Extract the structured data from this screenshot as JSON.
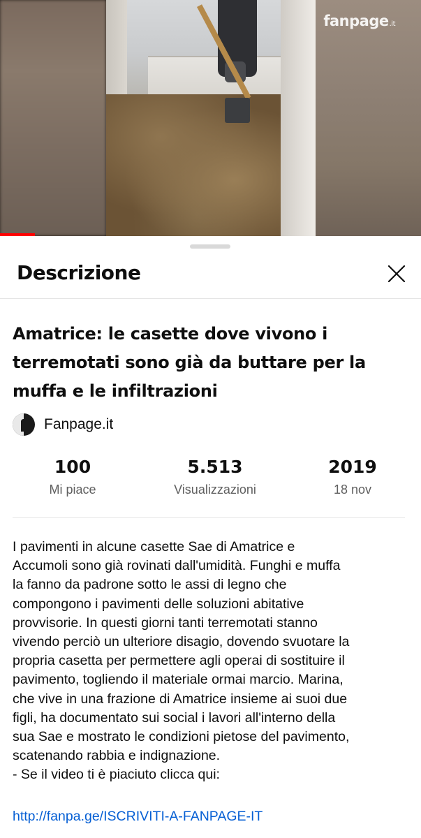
{
  "video": {
    "watermark": "fanpage",
    "watermark_suffix": ".it",
    "progress": 0.083
  },
  "sheet": {
    "title": "Descrizione",
    "close_icon": "close-icon"
  },
  "video_title": "Amatrice: le casette dove vivono i terremotati sono già da buttare per la muffa e le infiltrazioni",
  "channel": {
    "name": "Fanpage.it",
    "avatar_icon": "fanpage-logo-icon"
  },
  "stats": {
    "likes_value": "100",
    "likes_label": "Mi piace",
    "views_value": "5.513",
    "views_label": "Visualizzazioni",
    "year_value": "2019",
    "date_label": "18 nov"
  },
  "description": {
    "text": "I pavimenti in alcune casette Sae di Amatrice e\nAccumoli sono già rovinati dall'umidità. Funghi e muffa\nla fanno da padrone sotto le assi di legno che\ncompongono i pavimenti delle soluzioni abitative\nprovvisorie. In questi giorni tanti terremotati stanno\nvivendo perciò un ulteriore disagio, dovendo svuotare la\npropria casetta per permettere agli operai di sostituire il\npavimento, togliendo il materiale ormai marcio. Marina,\nche vive in una frazione di Amatrice insieme ai suoi due\nfigli, ha documentato sui social i lavori all'interno della\nsua Sae e mostrato le condizioni pietose del pavimento,\nscatenando rabbia e indignazione.\n- Se il video ti è piaciuto clicca qui:",
    "link": "http://fanpa.ge/ISCRIVITI-A-FANPAGE-IT"
  },
  "colors": {
    "progress": "#ff0000",
    "link": "#065fd4",
    "secondary_text": "#606060"
  }
}
